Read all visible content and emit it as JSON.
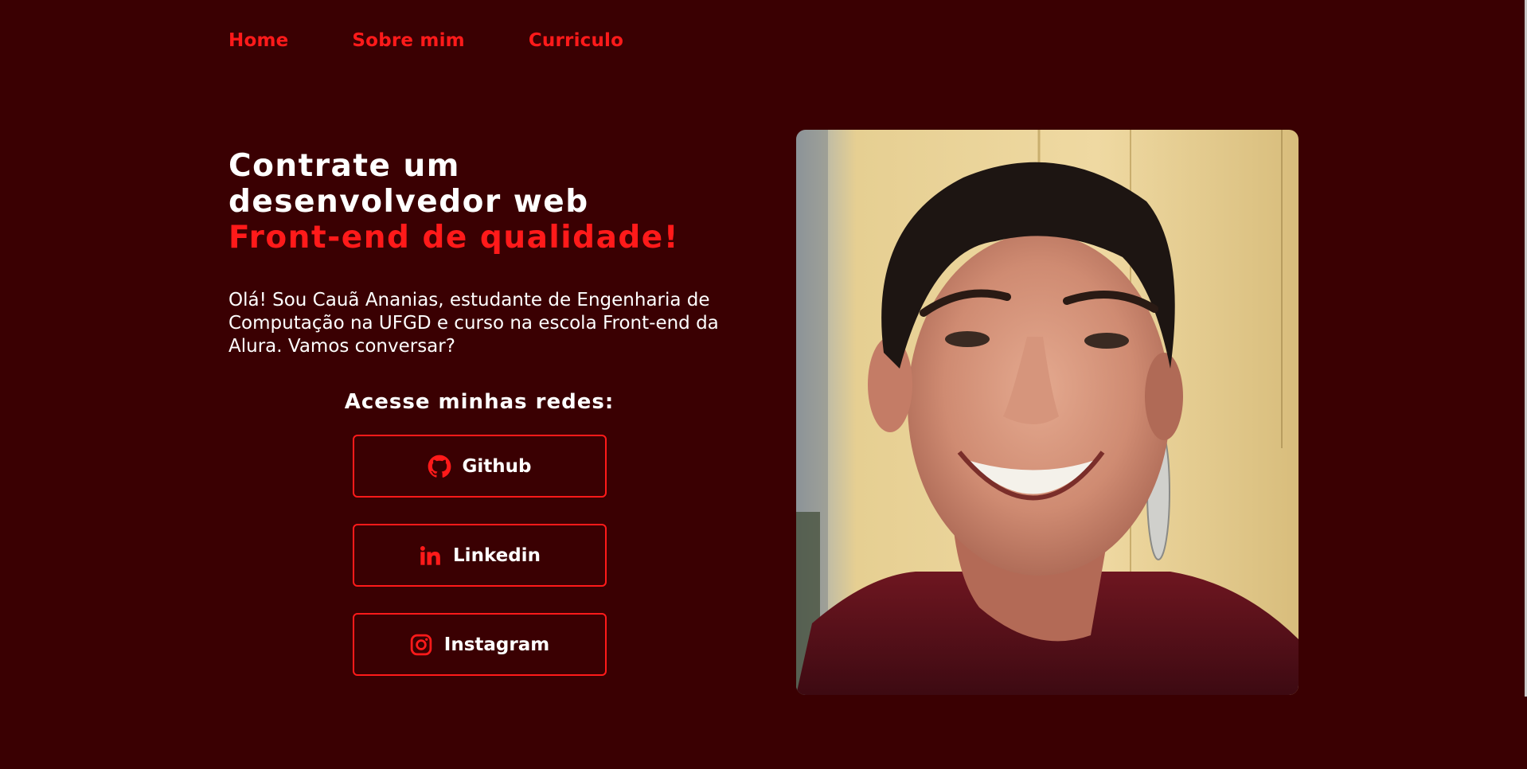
{
  "nav": {
    "items": [
      {
        "label": "Home"
      },
      {
        "label": "Sobre mim"
      },
      {
        "label": "Curriculo"
      }
    ]
  },
  "hero": {
    "headline_line1": "Contrate um",
    "headline_line2": "desenvolvedor web",
    "headline_accent": "Front-end de qualidade!",
    "intro": "Olá! Sou Cauã Ananias, estudante de Engenharia de Computação na UFGD e curso na escola Front-end da Alura. Vamos conversar?"
  },
  "social": {
    "title": "Acesse minhas redes:",
    "links": [
      {
        "label": "Github",
        "icon": "github-icon"
      },
      {
        "label": "Linkedin",
        "icon": "linkedin-icon"
      },
      {
        "label": "Instagram",
        "icon": "instagram-icon"
      }
    ]
  },
  "photo": {
    "subject": "profile-photo"
  },
  "colors": {
    "background": "#3a0002",
    "accent": "#ff1a1a",
    "text": "#ffffff"
  }
}
